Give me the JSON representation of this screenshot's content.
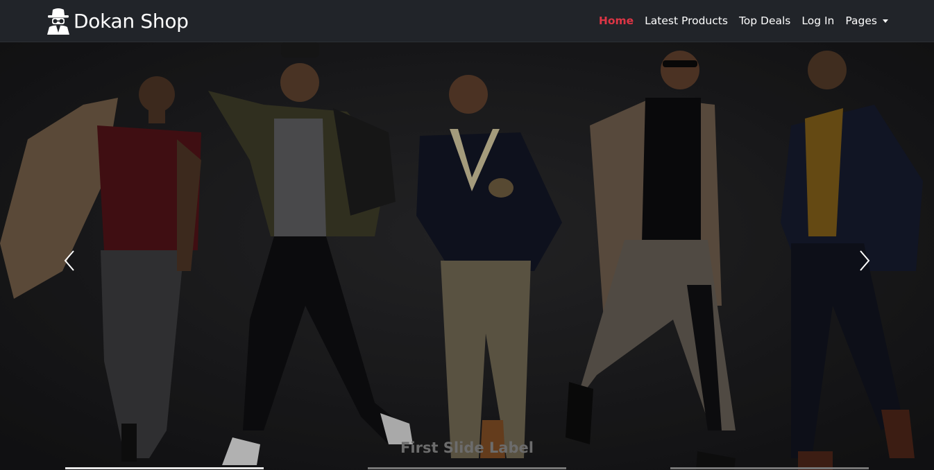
{
  "brand": {
    "name": "Dokan Shop",
    "icon": "spy-agent-icon"
  },
  "nav": {
    "items": [
      {
        "label": "Home",
        "active": true
      },
      {
        "label": "Latest Products",
        "active": false
      },
      {
        "label": "Top Deals",
        "active": false
      },
      {
        "label": "Log In",
        "active": false
      },
      {
        "label": "Pages",
        "active": false,
        "dropdown": true
      }
    ]
  },
  "carousel": {
    "caption": "First Slide Label",
    "active_slide": 1,
    "slide_count": 3,
    "prev_icon": "chevron-left-icon",
    "next_icon": "chevron-right-icon"
  },
  "colors": {
    "navbar_bg": "#212429",
    "active_link": "#dc3545",
    "link": "#ffffff",
    "caption": "#6c6c6c"
  }
}
